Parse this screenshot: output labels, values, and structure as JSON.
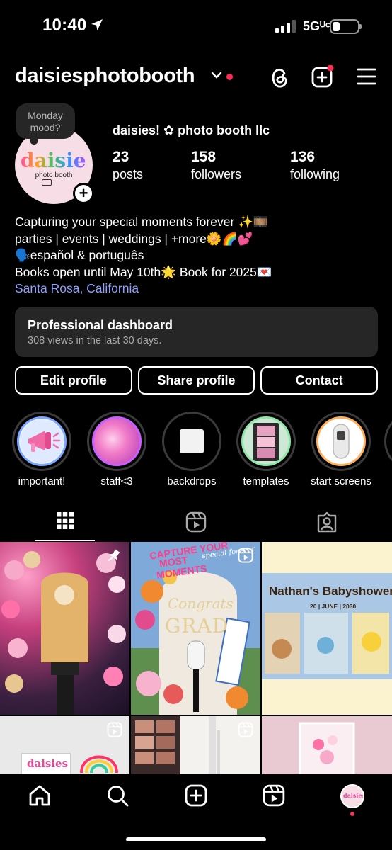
{
  "status": {
    "time": "10:40",
    "network": "5Gᵁᶜ"
  },
  "header": {
    "username": "daisiesphotobooth"
  },
  "profile": {
    "note": "Monday mood?",
    "avatar_logo": "daisies",
    "avatar_sub": "photo booth",
    "business_name": "daisies! ✿ photo booth llc",
    "stats": [
      {
        "num": "23",
        "label": "posts"
      },
      {
        "num": "158",
        "label": "followers"
      },
      {
        "num": "136",
        "label": "following"
      }
    ],
    "bio": [
      "Capturing your special moments forever ✨🎞️",
      "parties | events | weddings | +more🌼🌈💕",
      "🗣️español & português",
      "Books open until May 10th🌟 Book for 2025💌"
    ],
    "location": "Santa Rosa, California"
  },
  "dashboard": {
    "title": "Professional dashboard",
    "subtitle": "308 views in the last 30 days."
  },
  "buttons": {
    "edit": "Edit profile",
    "share": "Share profile",
    "contact": "Contact"
  },
  "highlights": [
    {
      "label": "important!",
      "icon": "megaphone-icon"
    },
    {
      "label": "staff<3",
      "icon": "photo"
    },
    {
      "label": "backdrops",
      "icon": "white-square"
    },
    {
      "label": "templates",
      "icon": "film-strip"
    },
    {
      "label": "start screens",
      "icon": "photo-booth"
    }
  ],
  "tabs": [
    "grid-icon",
    "reels-icon",
    "tagged-icon"
  ],
  "posts": {
    "post2_caption_1": "CAPTURE YOUR",
    "post2_caption_2": "MOST",
    "post2_caption_3": "MOMENTS",
    "post2_script": "special forever",
    "post2_congrats": "Congrats",
    "post2_grad": "GRAD",
    "post3_title": "Nathan's Babyshower",
    "post3_date": "20 | JUNE | 2030",
    "post4_logo": "daisies"
  },
  "nav": [
    "home-icon",
    "search-icon",
    "create-icon",
    "reels-icon",
    "profile-avatar"
  ],
  "colors": {
    "accent_red": "#ff2d55",
    "link": "#8ea1ff",
    "card_bg": "#262626"
  }
}
